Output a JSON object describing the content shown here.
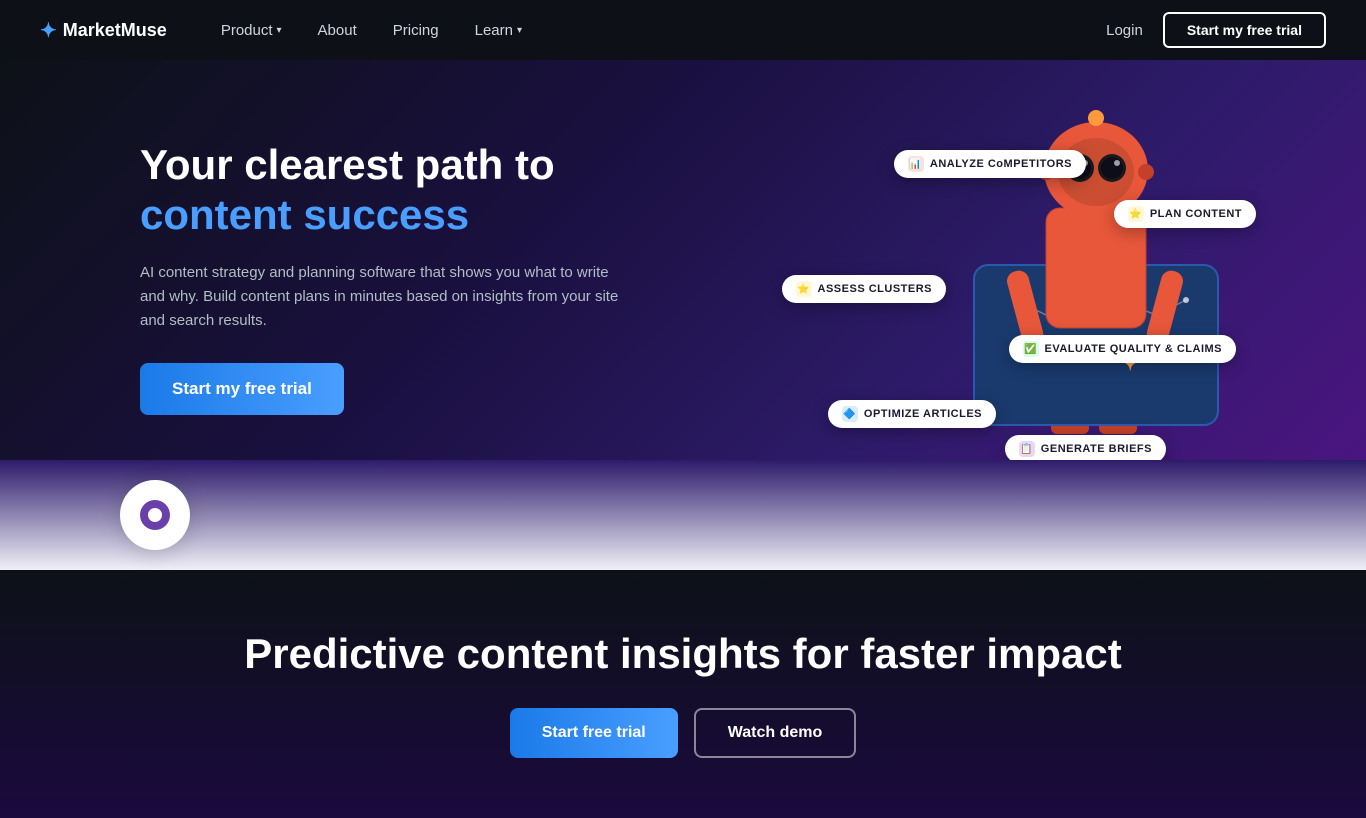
{
  "nav": {
    "logo": "MarketMuse",
    "logo_icon": "✦",
    "links": [
      {
        "label": "Product",
        "has_dropdown": true
      },
      {
        "label": "About",
        "has_dropdown": false
      },
      {
        "label": "Pricing",
        "has_dropdown": false
      },
      {
        "label": "Learn",
        "has_dropdown": true
      }
    ],
    "login_label": "Login",
    "cta_label": "Start my free trial"
  },
  "hero": {
    "title_line1": "Your clearest path to",
    "title_accent": "content success",
    "subtitle": "AI content strategy and planning software that shows you what to write and why. Build content plans in minutes based on insights from your site and search results.",
    "cta_label": "Start my free trial"
  },
  "chips": [
    {
      "id": "analyze",
      "label": "ANALYZE CoMPETITORS",
      "color": "#e8573a",
      "icon": "📊"
    },
    {
      "id": "plan",
      "label": "PLAN CONTENT",
      "color": "#f5c842",
      "icon": "⭐"
    },
    {
      "id": "assess",
      "label": "ASSESS CLUSTERS",
      "color": "#f5c842",
      "icon": "⭐"
    },
    {
      "id": "evaluate",
      "label": "EVALUATE QUALITY & CLAIMS",
      "color": "#4aaf6e",
      "icon": "✅"
    },
    {
      "id": "optimize",
      "label": "OPTIMIZE ARTICLES",
      "color": "#4a9eff",
      "icon": "🔷"
    },
    {
      "id": "generate",
      "label": "GENERATE BRIEFS",
      "color": "#6a3faa",
      "icon": "📋"
    }
  ],
  "bottom": {
    "title": "Predictive content insights for faster impact",
    "cta_primary": "Start free trial",
    "cta_secondary": "Watch demo"
  }
}
